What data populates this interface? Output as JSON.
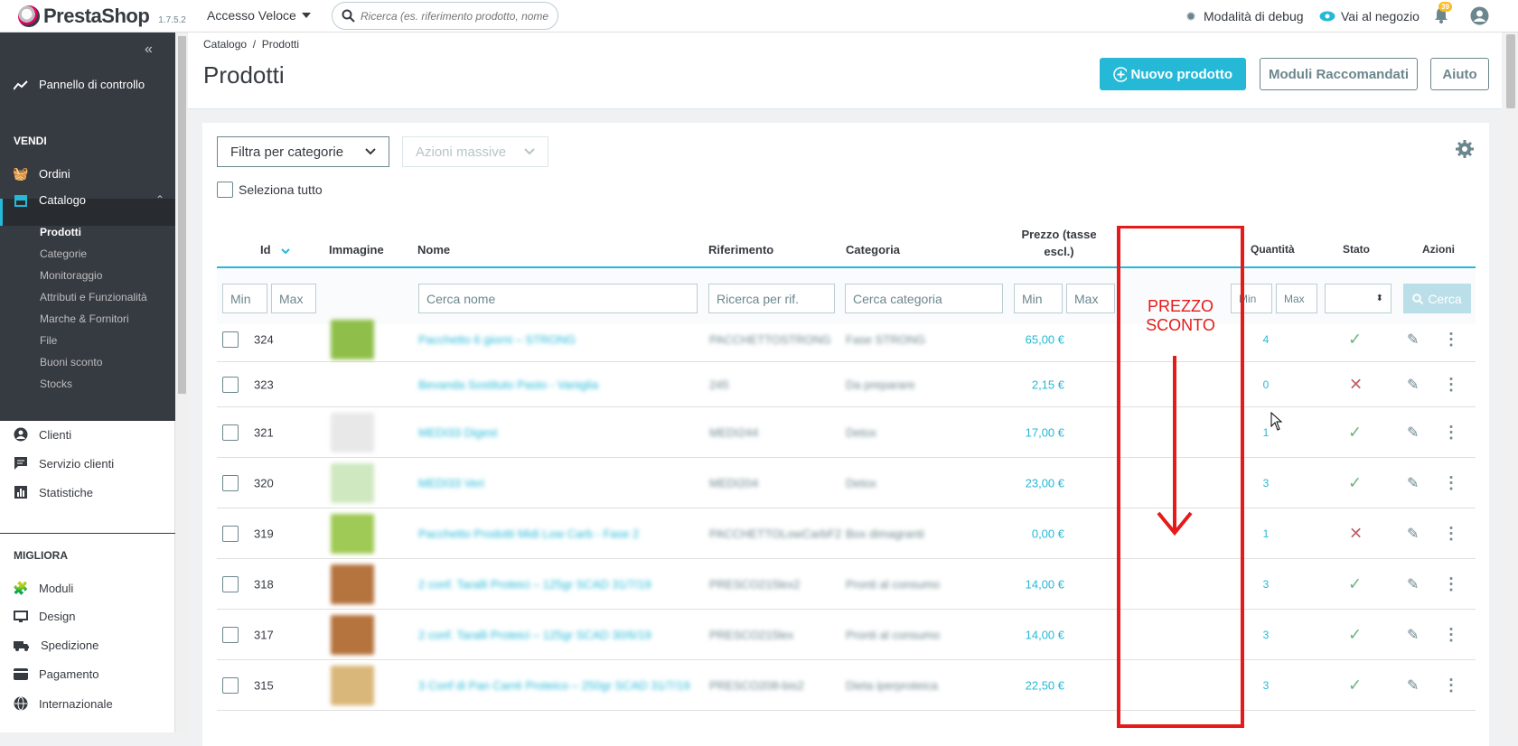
{
  "topbar": {
    "logo": "PrestaShop",
    "version": "1.7.5.2",
    "quick_access": "Accesso Veloce",
    "search_placeholder": "Ricerca (es. riferimento prodotto, nome",
    "debug": "Modalità di debug",
    "shop": "Vai al negozio",
    "notif_count": "39"
  },
  "sidebar": {
    "dashboard": "Pannello di controllo",
    "sell_heading": "VENDI",
    "orders": "Ordini",
    "catalog": "Catalogo",
    "catalog_sub": [
      "Prodotti",
      "Categorie",
      "Monitoraggio",
      "Attributi e Funzionalità",
      "Marche & Fornitori",
      "File",
      "Buoni sconto",
      "Stocks"
    ],
    "customers": "Clienti",
    "customer_service": "Servizio clienti",
    "stats": "Statistiche",
    "improve_heading": "MIGLIORA",
    "modules": "Moduli",
    "design": "Design",
    "shipping": "Spedizione",
    "payment": "Pagamento",
    "international": "Internazionale"
  },
  "header": {
    "breadcrumb": "Catalogo  /  Prodotti",
    "title": "Prodotti",
    "new_product": "Nuovo prodotto",
    "recommended": "Moduli Raccomandati",
    "help": "Aiuto"
  },
  "toolbar": {
    "filter_categories": "Filtra per categorie",
    "bulk_actions": "Azioni massive",
    "select_all": "Seleziona tutto"
  },
  "table": {
    "columns": [
      "Id",
      "Immagine",
      "Nome",
      "Riferimento",
      "Categoria",
      "Prezzo (tasse escl.)",
      "Quantità",
      "Stato",
      "Azioni"
    ],
    "filters": {
      "min": "Min",
      "max": "Max",
      "name": "Cerca nome",
      "ref": "Ricerca per rif.",
      "category": "Cerca categoria",
      "search_btn": "Cerca"
    },
    "rows": [
      {
        "id": "324",
        "name": "Pacchetto 6 giorni – STRONG",
        "ref": "PACCHETTOSTRONG",
        "category": "Fase STRONG",
        "price": "65,00 €",
        "qty": "4",
        "active": true
      },
      {
        "id": "323",
        "name": "Bevanda Sostituto Pasto - Vaniglia",
        "ref": "245",
        "category": "Da preparare",
        "price": "2,15 €",
        "qty": "0",
        "active": false
      },
      {
        "id": "321",
        "name": "MEDI33 Digest",
        "ref": "MEDI244",
        "category": "Detox",
        "price": "17,00 €",
        "qty": "1",
        "active": true
      },
      {
        "id": "320",
        "name": "MEDI33 Veri",
        "ref": "MEDI204",
        "category": "Detox",
        "price": "23,00 €",
        "qty": "3",
        "active": true
      },
      {
        "id": "319",
        "name": "Pacchetto Prodotti Midi Low Carb - Fase 2",
        "ref": "PACCHETTOLowCarbF2",
        "category": "Box dimagranti",
        "price": "0,00 €",
        "qty": "1",
        "active": false
      },
      {
        "id": "318",
        "name": "2 conf. Taralli Proteici – 125gr SCAD 31/7/19",
        "ref": "PRESCO215lex2",
        "category": "Pronti al consumo",
        "price": "14,00 €",
        "qty": "3",
        "active": true
      },
      {
        "id": "317",
        "name": "2 conf. Taralli Proteici – 125gr SCAD 30/6/19",
        "ref": "PRESCO215lex",
        "category": "Pronti al consumo",
        "price": "14,00 €",
        "qty": "3",
        "active": true
      },
      {
        "id": "315",
        "name": "3 Conf di Pan Carrè Proteico – 250gr SCAD 31/7/19",
        "ref": "PRESCO208-bis2",
        "category": "Dieta iperproteica",
        "price": "22,50 €",
        "qty": "3",
        "active": true
      }
    ]
  },
  "annotation": {
    "label_line1": "PREZZO",
    "label_line2": "SCONTO",
    "color": "#e51b1b"
  },
  "colors": {
    "accent": "#25b9d7",
    "sidebar": "#363a41",
    "ok": "#70b580",
    "ko": "#c05c67"
  }
}
